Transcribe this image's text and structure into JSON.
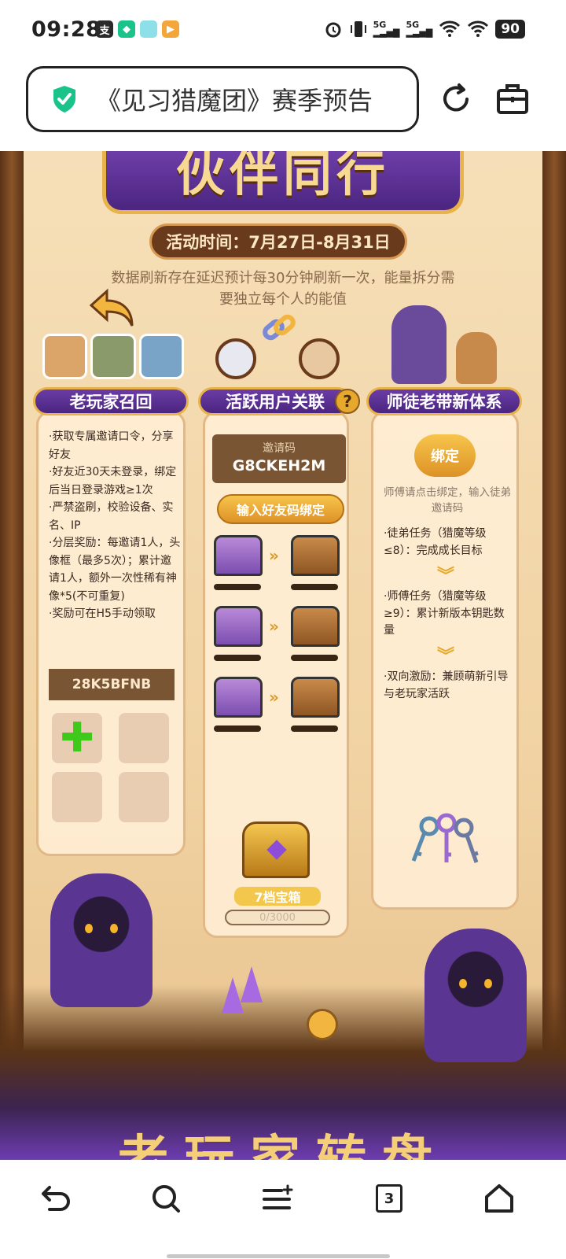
{
  "status_bar": {
    "time": "09:28",
    "network_1": "5G",
    "network_2": "5G",
    "battery": "90"
  },
  "browser": {
    "page_title": "《见习猎魔团》赛季预告",
    "icons": [
      "shield-check-icon",
      "reload-icon",
      "briefcase-icon"
    ]
  },
  "event": {
    "banner_title": "伙伴同行",
    "time_label": "活动时间：7月27日-8月31日",
    "notice": "数据刷新存在延迟预计每30分钟刷新一次，能量拆分需要独立每个人的能值",
    "columns": [
      {
        "title": "老玩家召回",
        "rules": "·获取专属邀请口令，分享好友\n·好友近30天未登录，绑定后当日登录游戏≥1次\n·严禁盗刷，校验设备、实名、IP\n·分层奖励：每邀请1人，头像框（最多5次）；累计邀请1人，额外一次性稀有神像*5(不可重复)\n·奖励可在H5手动领取",
        "code": "28K5BFNB"
      },
      {
        "title": "活跃用户关联",
        "help": "?",
        "invite_label": "邀请码",
        "invite_code": "G8CKEH2M",
        "bind_friend_button": "输入好友码绑定",
        "chest_caption": "7档宝箱",
        "progress_text": "0/3000"
      },
      {
        "title": "师徒老带新体系",
        "bind_button": "绑定",
        "bind_hint": "师傅请点击绑定，输入徒弟邀请码",
        "steps": [
          "·徒弟任务（猎魔等级≤8）：完成成长目标",
          "·师傅任务（猎魔等级≥9）：累计新版本钥匙数量",
          "·双向激励：兼顾萌新引导与老玩家活跃"
        ]
      }
    ],
    "bottom_banner_text": "老玩家转盘"
  },
  "nav": {
    "tab_count": "3",
    "items": [
      "back-icon",
      "search-icon",
      "menu-icon",
      "tabs-icon",
      "home-icon"
    ]
  },
  "colors": {
    "purple": "#5b3592",
    "gold": "#e7a92c",
    "brown": "#7a5534",
    "parchment": "#f6dfb8"
  }
}
